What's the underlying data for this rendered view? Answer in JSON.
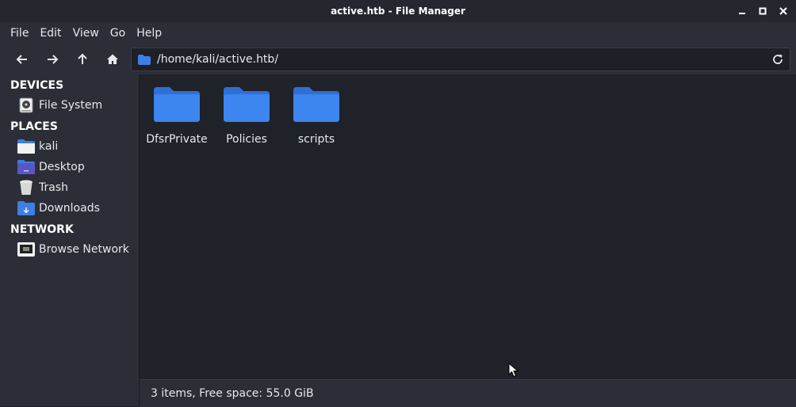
{
  "window": {
    "title": "active.htb - File Manager"
  },
  "menu": [
    "File",
    "Edit",
    "View",
    "Go",
    "Help"
  ],
  "toolbar": {
    "path": "/home/kali/active.htb/"
  },
  "sidebar": {
    "devices_heading": "DEVICES",
    "devices": [
      {
        "label": "File System",
        "icon": "harddisk-icon"
      }
    ],
    "places_heading": "PLACES",
    "places": [
      {
        "label": "kali",
        "icon": "home-folder-icon"
      },
      {
        "label": "Desktop",
        "icon": "desktop-icon"
      },
      {
        "label": "Trash",
        "icon": "trash-icon"
      },
      {
        "label": "Downloads",
        "icon": "downloads-folder-icon"
      }
    ],
    "network_heading": "NETWORK",
    "network": [
      {
        "label": "Browse Network",
        "icon": "network-icon"
      }
    ]
  },
  "files": [
    {
      "name": "DfsrPrivate",
      "icon": "folder-icon"
    },
    {
      "name": "Policies",
      "icon": "folder-icon"
    },
    {
      "name": "scripts",
      "icon": "folder-icon"
    }
  ],
  "status": {
    "text": "3 items, Free space: 55.0 GiB"
  },
  "colors": {
    "folder": "#3d7fe6",
    "background": "#1f2229",
    "panel": "#2b2e36"
  }
}
